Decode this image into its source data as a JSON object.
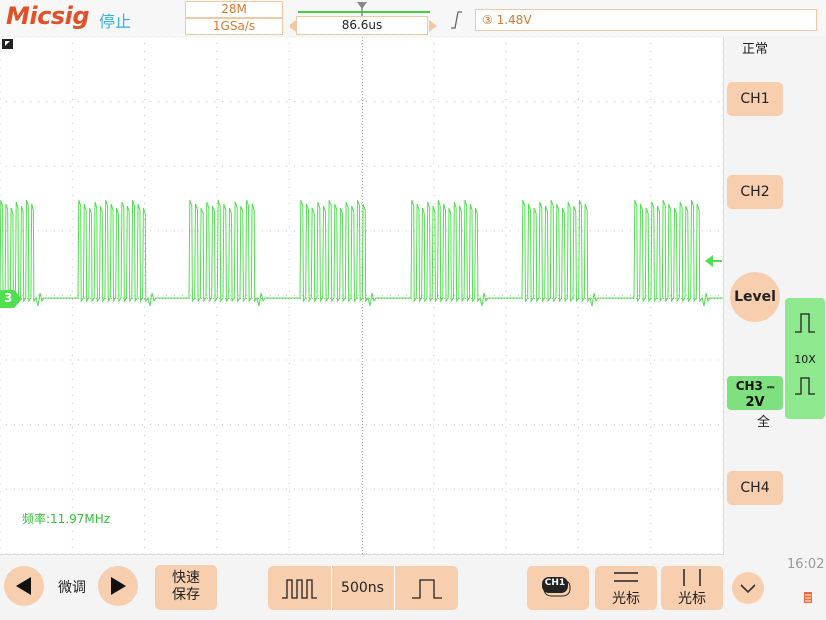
{
  "header": {
    "logo": "Micsig",
    "run_status": "停止",
    "memory_depth": "28M",
    "sample_rate": "1GSa/s",
    "time_offset": "86.6us",
    "trigger_level": "1.48V",
    "trigger_mode": "正常"
  },
  "screen": {
    "frequency_label": "频率:11.97MHz",
    "channel_marker": "3"
  },
  "right_panel": {
    "ch1_label": "CH1",
    "ch2_label": "CH2",
    "level_label": "Level",
    "ch3_name": "CH3",
    "ch3_scale": "2V",
    "ch3_coupling": "全",
    "ch4_label": "CH4",
    "probe_ratio": "10X"
  },
  "toolbar": {
    "fine_label": "微调",
    "quick_save_line1": "快速",
    "quick_save_line2": "保存",
    "timebase": "500ns",
    "ch1_select": "CH1",
    "cursor_h_label": "光标",
    "cursor_v_label": "光标"
  },
  "status": {
    "clock": "16:02"
  },
  "icons": {
    "logo_color": "#e2502a",
    "trace_color": "#4ee04e",
    "accent": "#f8cfae"
  }
}
